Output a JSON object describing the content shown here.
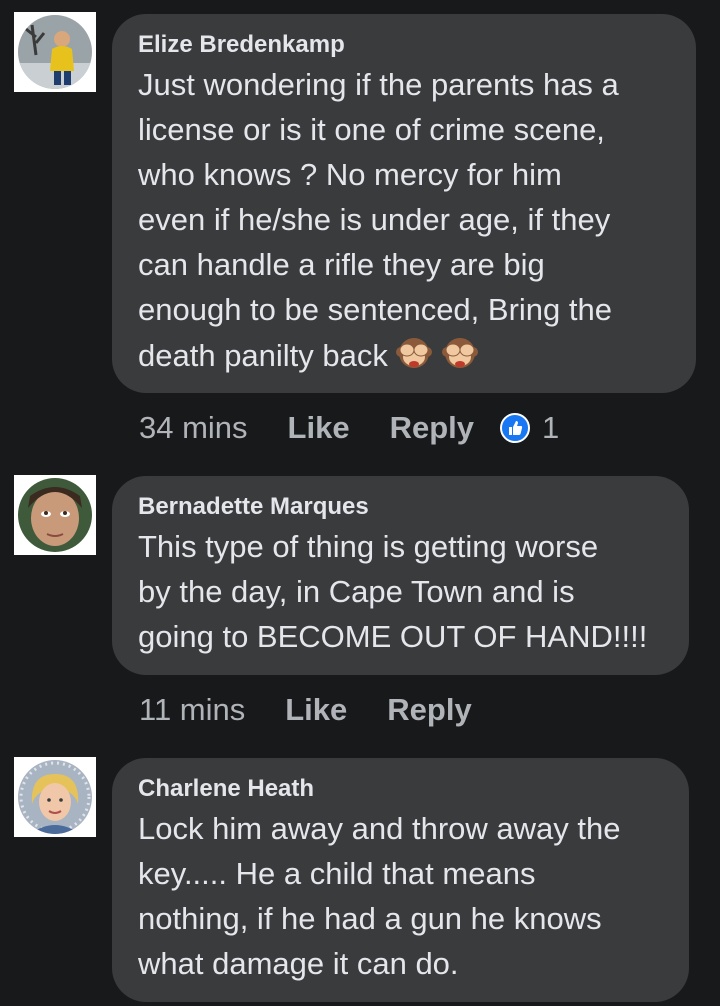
{
  "comments": [
    {
      "author": "Elize Bredenkamp",
      "lines": [
        "Just wondering if the parents has a",
        "license or is it one of crime scene,",
        "who knows ? No mercy for him",
        "even if he/she is under age, if they",
        "can handle a rifle they are big",
        "enough to be sentenced, Bring the",
        "death panilty back"
      ],
      "emoji": [
        "see-no-evil-monkey-icon",
        "see-no-evil-monkey-icon"
      ],
      "time": "34 mins",
      "like_label": "Like",
      "reply_label": "Reply",
      "reaction_icon": "like-reaction-icon",
      "reaction_count": "1"
    },
    {
      "author": "Bernadette Marques",
      "lines": [
        "This type of thing is getting worse",
        "by the day, in Cape Town and is",
        "going to BECOME OUT OF HAND!!!!"
      ],
      "time": "11 mins",
      "like_label": "Like",
      "reply_label": "Reply"
    },
    {
      "author": "Charlene Heath",
      "lines": [
        "Lock him away and throw away the",
        "key..... He a child that means",
        "nothing, if he had a gun he knows",
        "what damage it can do."
      ]
    }
  ],
  "colors": {
    "background": "#18191a",
    "bubble": "#3a3b3c",
    "text": "#e4e6eb",
    "secondary_text": "#b0b3b8",
    "like_blue": "#1877f2"
  }
}
